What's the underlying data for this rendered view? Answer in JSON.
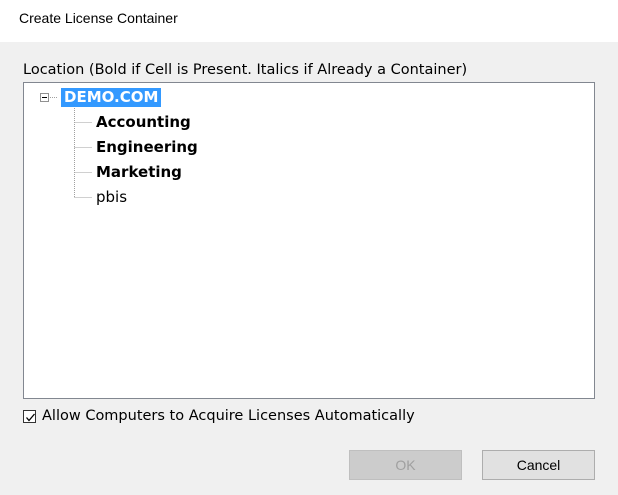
{
  "window": {
    "title": "Create License Container"
  },
  "location": {
    "label": "Location (Bold if Cell is Present. Italics if Already a Container)",
    "tree": {
      "root": {
        "label": "DEMO.COM",
        "expanded": true,
        "selected": true
      },
      "children": [
        {
          "label": "Accounting",
          "bold": true
        },
        {
          "label": "Engineering",
          "bold": true
        },
        {
          "label": "Marketing",
          "bold": true
        },
        {
          "label": "pbis",
          "bold": false
        }
      ]
    }
  },
  "options": {
    "auto_acquire_label": "Allow Computers to Acquire Licenses Automatically",
    "auto_acquire_checked": true
  },
  "buttons": {
    "ok_label": "OK",
    "ok_enabled": false,
    "cancel_label": "Cancel"
  },
  "colors": {
    "selection": "#3399ff",
    "dialog_bg": "#f0f0f0"
  }
}
